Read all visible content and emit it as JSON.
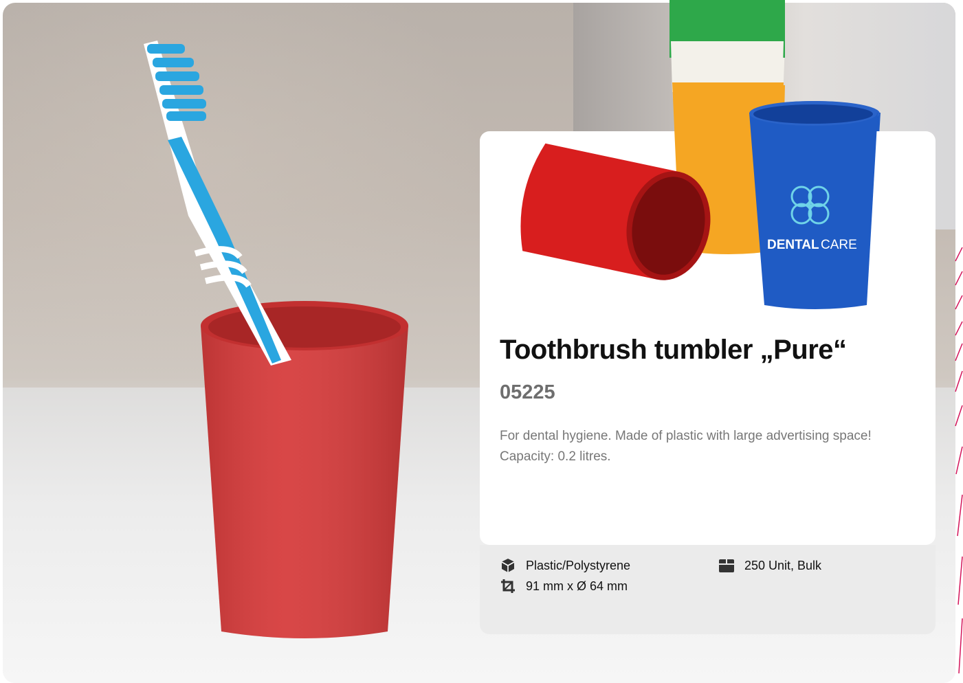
{
  "product": {
    "title": "Toothbrush tumbler „Pure“",
    "sku": "05225",
    "description": "For dental hygiene. Made of plastic with large advertising space! Capacity: 0.2 litres.",
    "logo_text_bold": "DENTAL",
    "logo_text_light": "CARE"
  },
  "specs": {
    "material": "Plastic/Polystyrene",
    "dimensions": "91 mm x Ø 64 mm",
    "packaging": "250 Unit, Bulk"
  },
  "icons": {
    "material": "cube-icon",
    "dimensions": "crop-icon",
    "packaging": "box-icon"
  },
  "colors": {
    "accent": "#d4145a",
    "tumbler_red": "#d83a3a",
    "tumbler_blue": "#1f5bc4",
    "tumbler_yellow": "#f5a623",
    "tumbler_green": "#2ea84a",
    "brush_blue": "#2aa6e0"
  }
}
